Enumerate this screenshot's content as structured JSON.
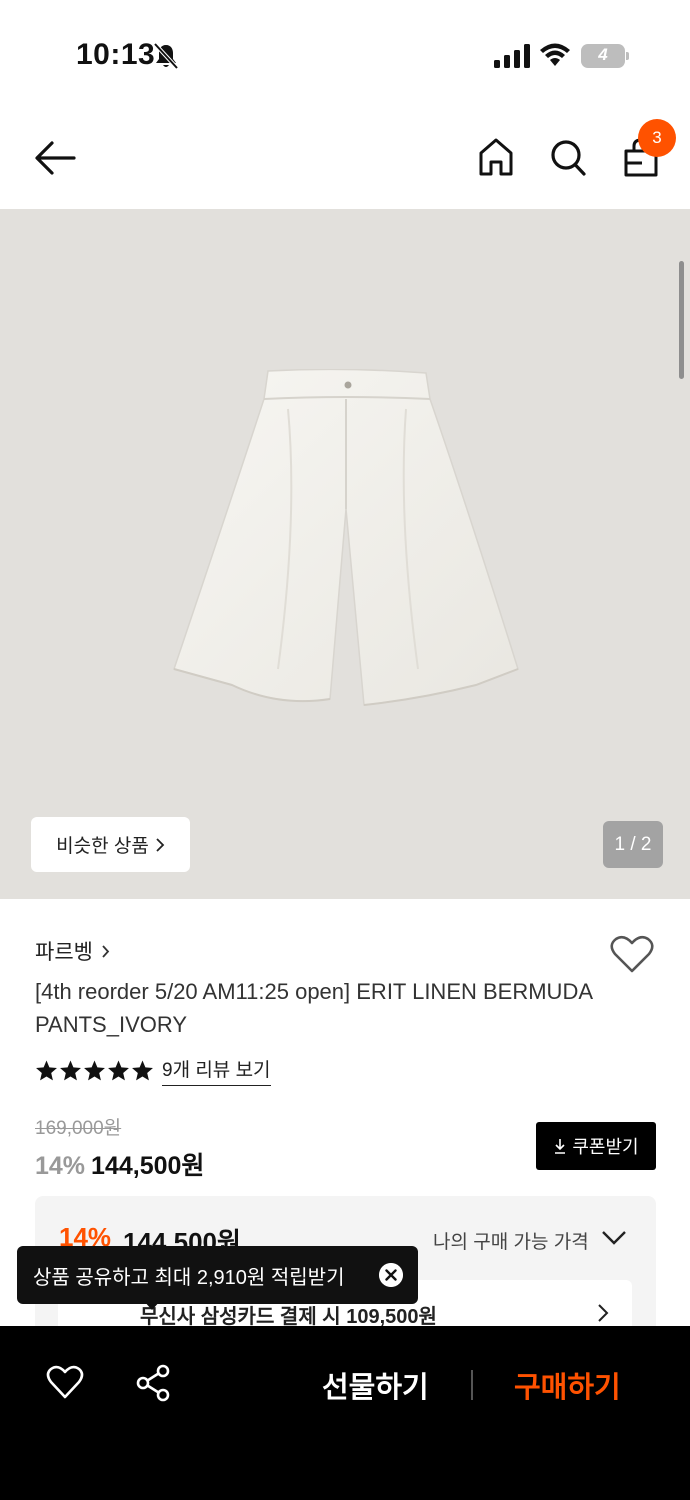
{
  "status_bar": {
    "time": "10:13",
    "battery": "4"
  },
  "header": {
    "cart_count": "3"
  },
  "hero": {
    "similar_label": "비슷한 상품",
    "page_indicator": "1 / 2"
  },
  "product": {
    "brand": "파르벵",
    "title": "[4th reorder 5/20 AM11:25 open] ERIT LINEN BERMUDA PANTS_IVORY",
    "rating_stars": 5,
    "review_link": "9개 리뷰 보기",
    "original_price": "169,000원",
    "discount_pct": "14%",
    "sale_price": "144,500원",
    "coupon_label": "쿠폰받기"
  },
  "my_price": {
    "discount_pct": "14%",
    "price": "144,500원",
    "label": "나의 구매 가능 가격",
    "card_offer": "무신사 삼성카드 결제 시 109,500원"
  },
  "toast": {
    "text": "상품 공유하고 최대 2,910원 적립받기"
  },
  "bottom_bar": {
    "gift_label": "선물하기",
    "buy_label": "구매하기"
  },
  "colors": {
    "accent": "#ff5200",
    "hero_bg": "#e2e0dc"
  }
}
